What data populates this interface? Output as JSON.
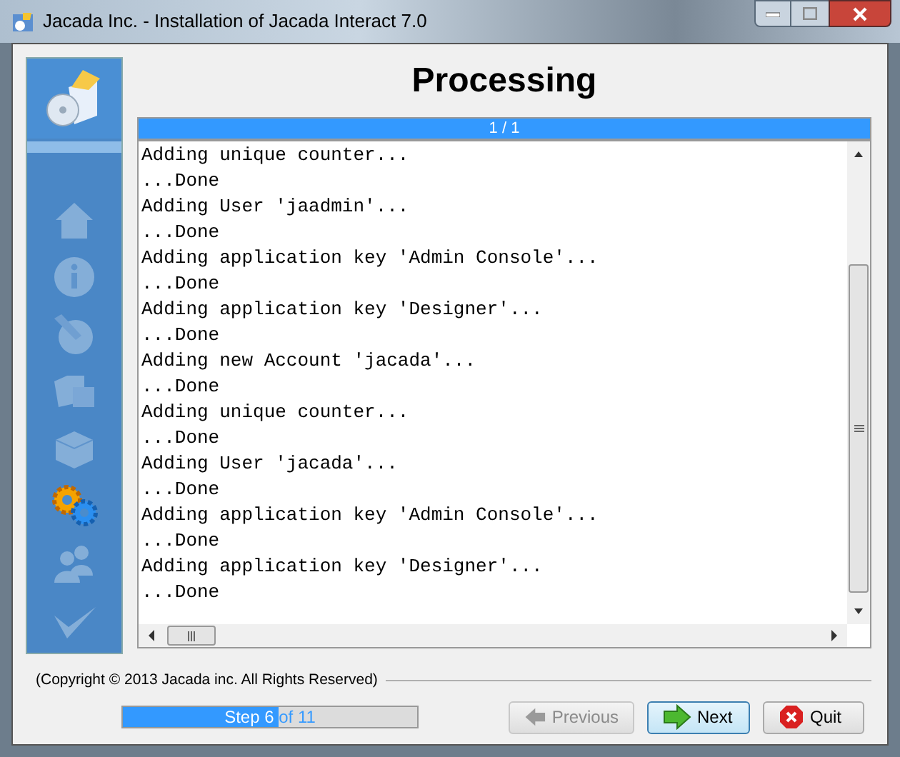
{
  "window": {
    "title": "Jacada Inc. - Installation of Jacada Interact 7.0"
  },
  "sidebar": {
    "items": [
      {
        "kind": "home",
        "selected": false
      },
      {
        "kind": "info",
        "selected": false
      },
      {
        "kind": "tools",
        "selected": false
      },
      {
        "kind": "folders",
        "selected": false
      },
      {
        "kind": "box",
        "selected": false
      },
      {
        "kind": "gears",
        "selected": true
      },
      {
        "kind": "users",
        "selected": false
      },
      {
        "kind": "check",
        "selected": false
      }
    ]
  },
  "heading": "Processing",
  "task_progress": {
    "label": "1 / 1",
    "level": 1
  },
  "log": {
    "lines": [
      "Adding unique counter...",
      "...Done",
      "Adding User 'jaadmin'...",
      "...Done",
      "Adding application key 'Admin Console'...",
      "...Done",
      "Adding application key 'Designer'...",
      "...Done",
      "Adding new Account 'jacada'...",
      "...Done",
      "Adding unique counter...",
      "...Done",
      "Adding User 'jacada'...",
      "...Done",
      "Adding application key 'Admin Console'...",
      "...Done",
      "Adding application key 'Designer'...",
      "...Done"
    ]
  },
  "copyright": "(Copyright © 2013 Jacada inc. All Rights Reserved)",
  "step_progress": {
    "label": "Step 6 of 11",
    "level": 0.53
  },
  "buttons": [
    {
      "kind": "previous",
      "label": "Previous",
      "disabled": true,
      "focused": false
    },
    {
      "kind": "next",
      "label": "Next",
      "disabled": false,
      "focused": true
    },
    {
      "kind": "quit",
      "label": "Quit",
      "disabled": false,
      "focused": false
    }
  ]
}
